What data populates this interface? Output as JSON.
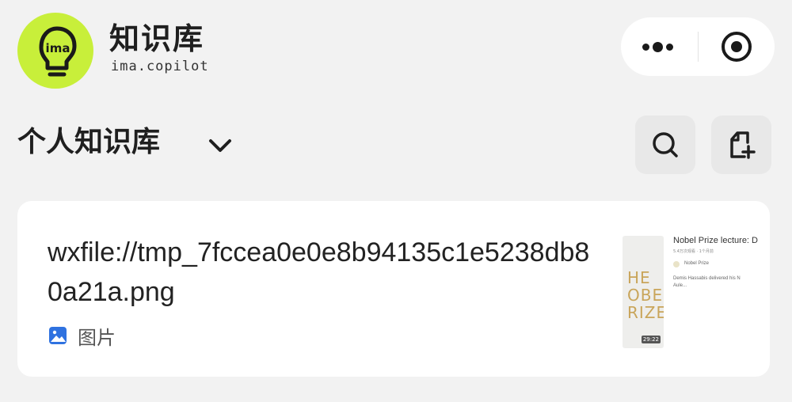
{
  "header": {
    "logo_text": "ima",
    "app_title": "知识库",
    "app_subtitle": "ima.copilot",
    "logo_color": "#c8ef3a"
  },
  "capsule": {
    "more_icon": "more-dots-icon",
    "close_icon": "target-close-icon"
  },
  "section": {
    "title": "个人知识库",
    "dropdown_icon": "chevron-down-icon",
    "search_icon": "search-icon",
    "add_icon": "add-document-icon"
  },
  "file_card": {
    "file_name": "wxfile://tmp_7fccea0e0e8b94135c1e5238db80a21a.png",
    "type_icon": "image-icon",
    "type_label": "图片",
    "type_icon_color": "#2f72e0",
    "thumbnail": {
      "cover_text": "HE\nOBEL\nRIZE",
      "duration": "29:22",
      "title": "Nobel Prize lecture: D",
      "meta": "5.4万次观看 · 1个月前",
      "channel": "Nobel Prize",
      "description": "Demis Hassabis delivered his N Aule..."
    }
  }
}
